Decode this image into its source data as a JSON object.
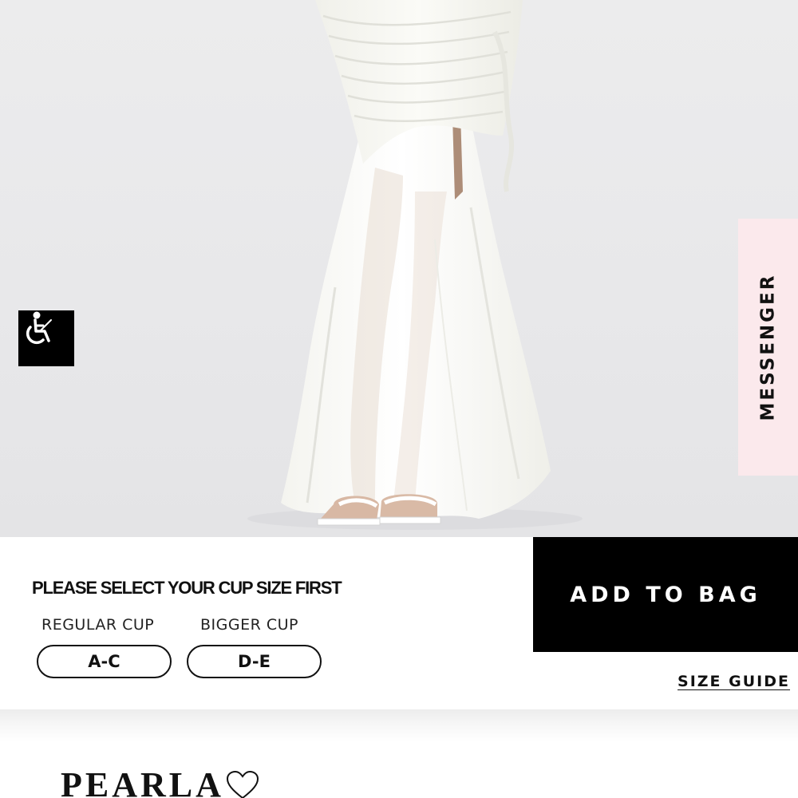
{
  "hero": {
    "image": "white-chiffon-maxi-dress",
    "background_color": "#e9e9eb"
  },
  "accessibility": {
    "icon": "wheelchair-icon"
  },
  "messenger": {
    "label": "MESSENGER",
    "background_color": "#fbe9ec"
  },
  "cup_selector": {
    "prompt": "PLEASE SELECT YOUR CUP SIZE FIRST",
    "options": [
      {
        "group_label": "REGULAR CUP",
        "value": "A-C"
      },
      {
        "group_label": "BIGGER CUP",
        "value": "D-E"
      }
    ]
  },
  "actions": {
    "add_to_bag": "ADD TO BAG",
    "size_guide": "SIZE GUIDE"
  },
  "product": {
    "title": "PEARLA",
    "wishlist_icon": "heart-outline-icon"
  }
}
